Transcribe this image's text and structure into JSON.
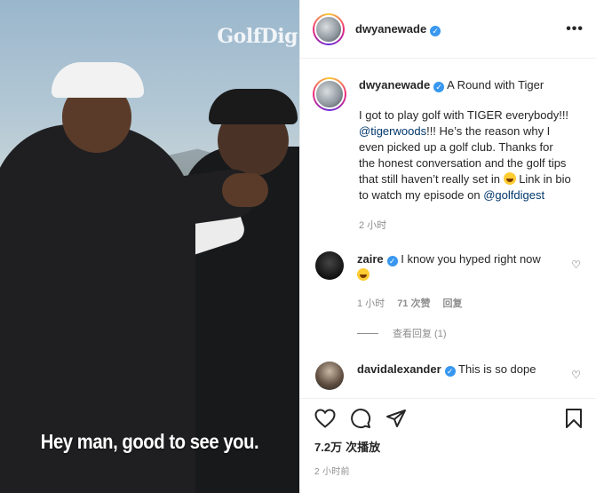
{
  "media": {
    "watermark": "GolfDig",
    "subtitle": "Hey man, good to see you."
  },
  "header": {
    "username": "dwyanewade",
    "more_label": "•••"
  },
  "caption": {
    "username": "dwyanewade",
    "title": "A Round with Tiger",
    "text_1": "I got to play golf with TIGER everybody!!! ",
    "mention_1": "@tigerwoods",
    "text_2": "!!! He’s the reason why I even picked up a golf club. Thanks for the honest conversation and the golf tips that still haven’t really set in ",
    "text_3": " Link in bio to watch my episode on ",
    "mention_2": "@golfdigest",
    "time": "2 小时"
  },
  "comments": [
    {
      "username": "zaire",
      "text": "I know you hyped right now",
      "time": "1 小时",
      "likes": "71 次赞",
      "reply_label": "回复",
      "view_replies": "查看回复 (1)"
    },
    {
      "username": "davidalexander",
      "text": "This is so dope"
    }
  ],
  "footer": {
    "views_count": "7.2万",
    "views_label": "次播放",
    "timestamp": "2 小时前"
  },
  "colors": {
    "verified": "#3897f0",
    "link": "#00376b",
    "meta": "#8e8e8e"
  }
}
